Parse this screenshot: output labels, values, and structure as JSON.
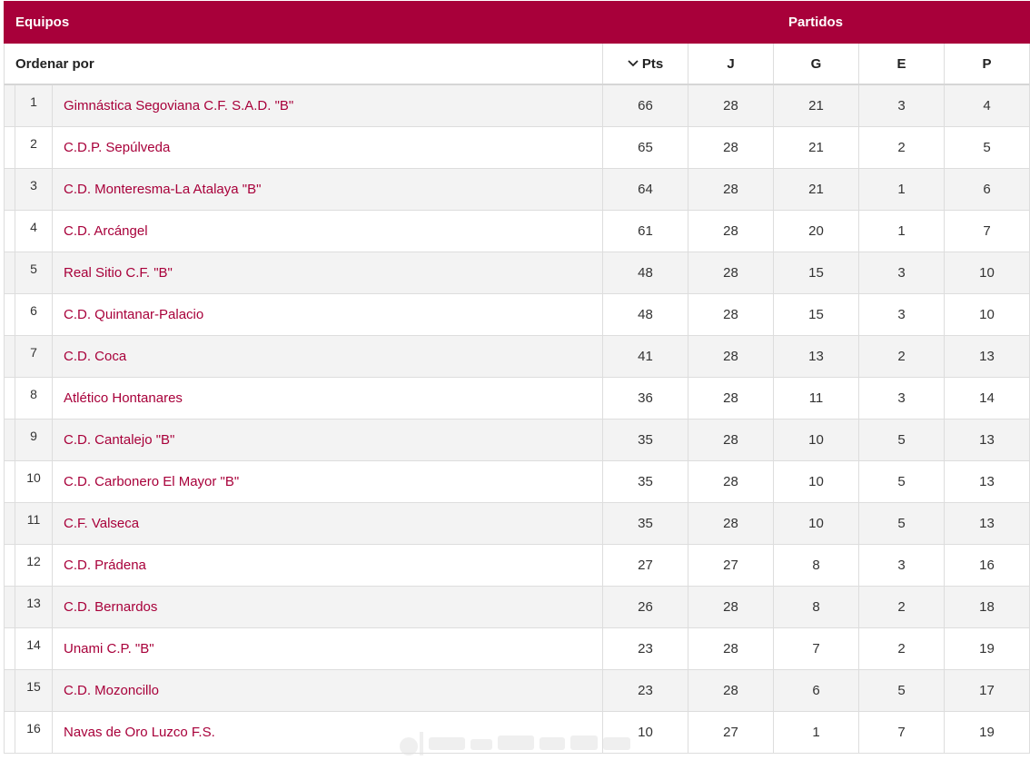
{
  "header": {
    "teams_label": "Equipos",
    "matches_label": "Partidos"
  },
  "sort": {
    "label": "Ordenar por",
    "columns": {
      "pts": "Pts",
      "j": "J",
      "g": "G",
      "e": "E",
      "p": "P"
    },
    "active": "Pts",
    "icon": "chevron-down-icon"
  },
  "colors": {
    "accent": "#a8003a",
    "row_alt": "#f3f3f3"
  },
  "rows": [
    {
      "rank": "1",
      "team": "Gimnástica Segoviana C.F. S.A.D. \"B\"",
      "pts": "66",
      "j": "28",
      "g": "21",
      "e": "3",
      "p": "4"
    },
    {
      "rank": "2",
      "team": "C.D.P. Sepúlveda",
      "pts": "65",
      "j": "28",
      "g": "21",
      "e": "2",
      "p": "5"
    },
    {
      "rank": "3",
      "team": "C.D. Monteresma-La Atalaya \"B\"",
      "pts": "64",
      "j": "28",
      "g": "21",
      "e": "1",
      "p": "6"
    },
    {
      "rank": "4",
      "team": "C.D. Arcángel",
      "pts": "61",
      "j": "28",
      "g": "20",
      "e": "1",
      "p": "7"
    },
    {
      "rank": "5",
      "team": "Real Sitio C.F. \"B\"",
      "pts": "48",
      "j": "28",
      "g": "15",
      "e": "3",
      "p": "10"
    },
    {
      "rank": "6",
      "team": "C.D. Quintanar-Palacio",
      "pts": "48",
      "j": "28",
      "g": "15",
      "e": "3",
      "p": "10"
    },
    {
      "rank": "7",
      "team": "C.D. Coca",
      "pts": "41",
      "j": "28",
      "g": "13",
      "e": "2",
      "p": "13"
    },
    {
      "rank": "8",
      "team": "Atlético Hontanares",
      "pts": "36",
      "j": "28",
      "g": "11",
      "e": "3",
      "p": "14"
    },
    {
      "rank": "9",
      "team": "C.D. Cantalejo \"B\"",
      "pts": "35",
      "j": "28",
      "g": "10",
      "e": "5",
      "p": "13"
    },
    {
      "rank": "10",
      "team": "C.D. Carbonero El Mayor \"B\"",
      "pts": "35",
      "j": "28",
      "g": "10",
      "e": "5",
      "p": "13"
    },
    {
      "rank": "11",
      "team": "C.F. Valseca",
      "pts": "35",
      "j": "28",
      "g": "10",
      "e": "5",
      "p": "13"
    },
    {
      "rank": "12",
      "team": "C.D. Prádena",
      "pts": "27",
      "j": "27",
      "g": "8",
      "e": "3",
      "p": "16"
    },
    {
      "rank": "13",
      "team": "C.D. Bernardos",
      "pts": "26",
      "j": "28",
      "g": "8",
      "e": "2",
      "p": "18"
    },
    {
      "rank": "14",
      "team": "Unami C.P. \"B\"",
      "pts": "23",
      "j": "28",
      "g": "7",
      "e": "2",
      "p": "19"
    },
    {
      "rank": "15",
      "team": "C.D. Mozoncillo",
      "pts": "23",
      "j": "28",
      "g": "6",
      "e": "5",
      "p": "17"
    },
    {
      "rank": "16",
      "team": "Navas de Oro Luzco F.S.",
      "pts": "10",
      "j": "27",
      "g": "1",
      "e": "7",
      "p": "19"
    }
  ]
}
